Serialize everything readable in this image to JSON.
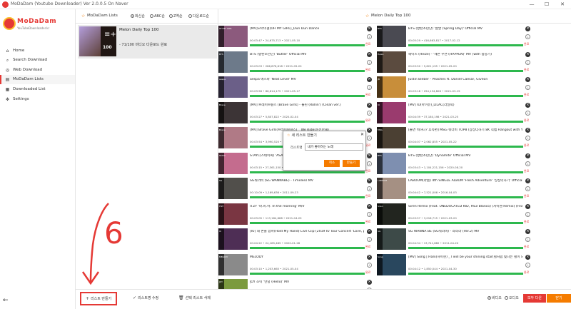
{
  "window": {
    "title": "MoDaDam (Youtube Downloader) Ver 2.0.0.5 On Naver",
    "min": "—",
    "max": "☐",
    "close": "✕"
  },
  "sidebar": {
    "logo_name": "MoDaDam",
    "logo_sub": "YouTubeDownloader.kr",
    "items": [
      {
        "label": "Home",
        "icon": "home-icon",
        "glyph": "⌂"
      },
      {
        "label": "Search Download",
        "icon": "search-icon",
        "glyph": "⌕"
      },
      {
        "label": "Web Download",
        "icon": "globe-icon",
        "glyph": "◎"
      },
      {
        "label": "MoDaDam Lists",
        "icon": "list-icon",
        "glyph": "▤"
      },
      {
        "label": "Downloaded List",
        "icon": "stack-icon",
        "glyph": "▦"
      },
      {
        "label": "Settings",
        "icon": "gear-icon",
        "glyph": "✻"
      }
    ],
    "back": "←"
  },
  "lists": {
    "title": "MoDaDam Lists",
    "sort": [
      "최신순",
      "ABC순",
      "Z역순",
      "다운로드순"
    ],
    "card": {
      "name": "Melon Daily Top 100",
      "progress": "- 71/100 비디오 다운로드 완료",
      "count": "100",
      "plus": "≡+"
    }
  },
  "songs": {
    "title": "Melon Daily Top 100",
    "done_label": "완료",
    "items": [
      {
        "title": "[MV]오마이걸(OH MY GIRL)_Dun Dun Dance",
        "meta": "00:03:47 • 24,675,713 • 2021-05-10",
        "color": "#8c5a7d",
        "tag": "OH MY GIRL"
      },
      {
        "title": "BTS (방탄소년단) '봄날 (Spring Day)' Official MV",
        "meta": "00:05:29 • 416,663,817 • 2017-02-12",
        "color": "#4a4a52",
        "tag": "BTS"
      },
      {
        "title": "BTS (방탄소년단) 'Butter' Official MV",
        "meta": "00:03:03 • 286,876,618 • 2021-05-20",
        "color": "#6d7a8a",
        "tag": "BTS"
      },
      {
        "title": "헤이즈 (Heize) - '헤픈 우연 (HAPPEN)' MV (with 송중기)",
        "meta": "00:03:50 • 5,821,195 • 2021-05-20",
        "color": "#5b4b3f",
        "tag": "Heize"
      },
      {
        "title": "aespa 에스파 'Next Level' MV",
        "meta": "00:03:56 • 86,614,175 • 2021-05-17",
        "color": "#6b5f88",
        "tag": "aespa"
      },
      {
        "title": "Justin Bieber - Peaches ft. Daniel Caesar, Giveon",
        "meta": "00:03:18 • 254,134,806 • 2021-03-19",
        "color": "#c88e3a",
        "tag": "JB"
      },
      {
        "title": "[MV] 브레이브걸스 (Brave Girls) - 롤린 (Rollin') (Clean ver.)",
        "meta": "00:03:27 • 5,807,822 • 2020-02-04",
        "color": "#3c3436",
        "tag": "Brave"
      },
      {
        "title": "[MV] IU(아이유)_LILAC(라일락)",
        "meta": "00:04:39 • 37,180,198 • 2021-03-25",
        "color": "#9a3b6e",
        "tag": "IU"
      },
      {
        "title": "[MV] Brave Girls(브레이브걸스) _ We Ride(운전만해)",
        "meta": "00:03:54 • 3,990,520 • 2020-08-14",
        "color": "#b07a86",
        "tag": "Brave"
      },
      {
        "title": "[놀면 뭐하니? 후속편] MSG 워너비 TOP8 (상상더하기 8K 직캠 Hangout with Yoo - MSG Wannabe YooYaHo)",
        "meta": "00:04:07 • 2,062,855 • 2021-05-22",
        "color": "#4b4033",
        "tag": "MSG"
      },
      {
        "title": "STAYC(스테이씨) 'ASAP' MV",
        "meta": "00:03:15 • 27,361,150 • 2021-04-08",
        "color": "#c46c8e",
        "tag": "STAYC"
      },
      {
        "title": "BTS (방탄소년단) 'Dynamite' Official MV",
        "meta": "00:03:43 • 1,104,221,156 • 2020-08-20",
        "color": "#7e8fb0",
        "tag": "BTS"
      },
      {
        "title": "SG워너비 (SG WANNABE) - Timeless MV",
        "meta": "00:10:09 • 1,169,636 • 2011-09-23",
        "color": "#514f4b",
        "tag": "SG"
      },
      {
        "title": "LABOUM(라붐) 4th SINGLE ALBUM 'Fresh Adventure' '상상더하기' Official M/V",
        "meta": "00:04:42 • 7,521,006 • 2016-04-03",
        "color": "#a59083",
        "tag": "LABOUM"
      },
      {
        "title": "ITZY '마.피.아. In the morning' M/V",
        "meta": "00:03:05 • 113,184,688 • 2021-04-29",
        "color": "#7a3642",
        "tag": "ITZY"
      },
      {
        "title": "Siren Remix (Feat. UNEDUCATED KID, Paul Blanco) (사이렌 Remix) (Feat. UNEDUCATED KID, Paul...",
        "meta": "00:03:57 • 3,018,715 • 2021-03-20",
        "color": "#22251f",
        "tag": "Siren"
      },
      {
        "title": "[IU] 내 손을 잡아(Hold My Hand) Live Clip (2019 IU Tour Concert 'Love, poem')",
        "meta": "00:04:22 • 24,185,489 • 2020-01-28",
        "color": "#4e2e55",
        "tag": "IU"
      },
      {
        "title": "SG WANNA BE (SG워너비) - 라라라 (Ver.2) MV",
        "meta": "00:04:34 • 13,741,882 • 2011-04-20",
        "color": "#3d4a48",
        "tag": "SG"
      },
      {
        "title": "MELODY",
        "meta": "00:03:10 • 1,203,665 • 2021-05-04",
        "color": "#8a8a8a",
        "tag": "MELODY"
      },
      {
        "title": "[MV] Song | Hani(하이현) _ I will be your shining star(별처럼 빛나는 별이 되어 비쳐줄게)",
        "meta": "00:04:12 • 1,850,044 • 2021-04-30",
        "color": "#29475e",
        "tag": "Song"
      },
      {
        "title": "JOY 조이 '안녕 (Hello)' MV",
        "meta": "00:03:32 • 22,144,011 • 2021-05-31",
        "color": "#7b9a3e",
        "tag": "JOY"
      }
    ]
  },
  "dialog": {
    "title": "새 리스트 만들기",
    "label": "리스트명",
    "value": "내가 좋아하는 노래",
    "cancel": "취소",
    "ok": "만들기",
    "close": "✕"
  },
  "bottom": {
    "create": "리스트 만들기",
    "rename": "리스트명 수정",
    "delete": "선택 리스트 삭제",
    "video": "비디오",
    "audio": "오디오",
    "download_all": "모두 다운",
    "close": "닫기"
  },
  "annotation": {
    "number": "6",
    "color": "#e53935"
  }
}
